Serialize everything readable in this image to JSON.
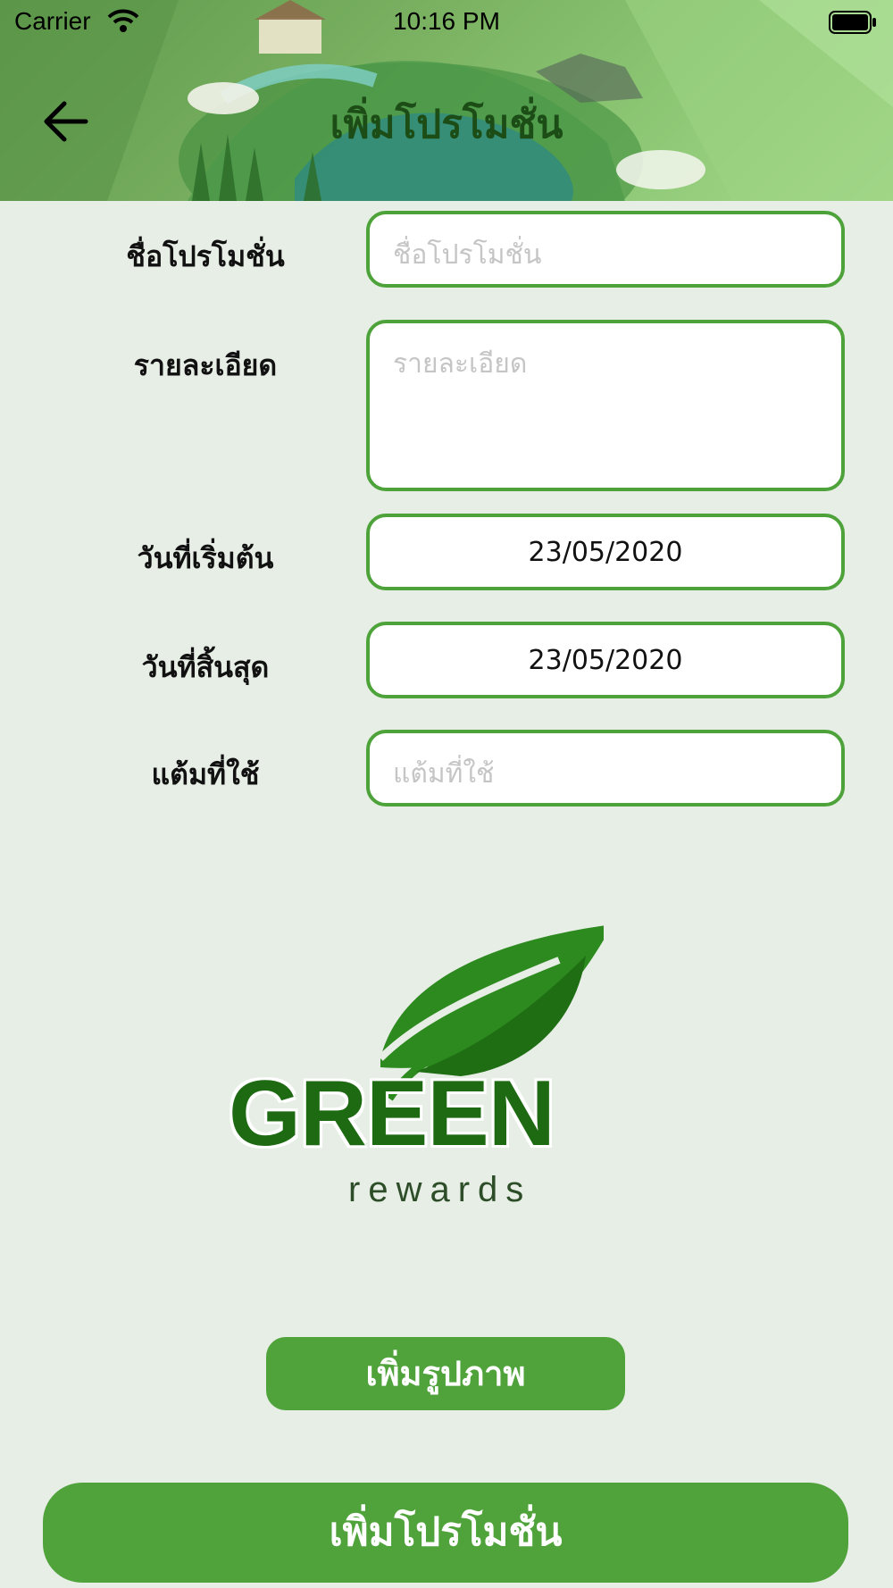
{
  "status_bar": {
    "carrier": "Carrier",
    "time": "10:16 PM"
  },
  "header": {
    "title": "เพิ่มโปรโมชั่น",
    "back_icon": "arrow-left-icon"
  },
  "form": {
    "promo_name": {
      "label": "ชื่อโปรโมชั่น",
      "placeholder": "ชื่อโปรโมชั่น",
      "value": ""
    },
    "details": {
      "label": "รายละเอียด",
      "placeholder": "รายละเอียด",
      "value": ""
    },
    "start_date": {
      "label": "วันที่เริ่มต้น",
      "value": "23/05/2020"
    },
    "end_date": {
      "label": "วันที่สิ้นสุด",
      "value": "23/05/2020"
    },
    "points": {
      "label": "แต้มที่ใช้",
      "placeholder": "แต้มที่ใช้",
      "value": ""
    }
  },
  "logo": {
    "brand": "GREEN",
    "sub": "rewards",
    "icon": "leaf-icon"
  },
  "buttons": {
    "add_image": "เพิ่มรูปภาพ",
    "submit": "เพิ่มโปรโมชั่น"
  },
  "colors": {
    "accent": "#4fa33a",
    "background": "#e7eee6",
    "title": "#1d4d16"
  }
}
